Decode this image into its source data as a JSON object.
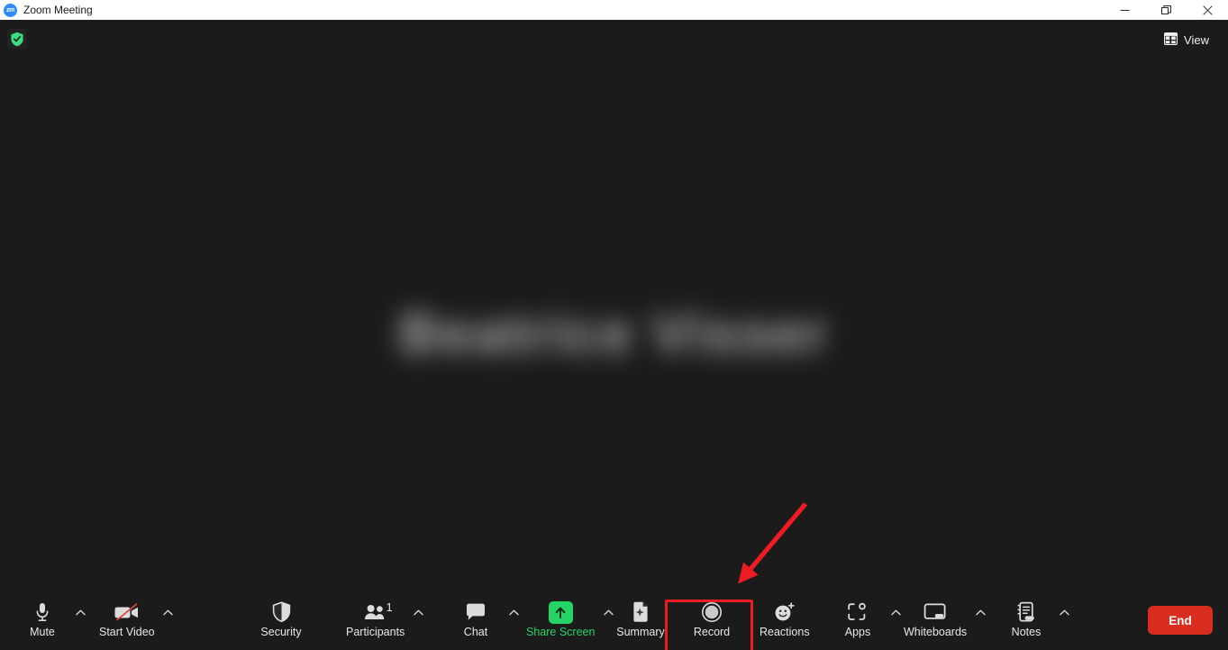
{
  "window": {
    "title": "Zoom Meeting",
    "logo_text": "zm",
    "controls": {
      "minimize": "minimize-icon",
      "maximize": "maximize-icon",
      "close": "close-icon"
    }
  },
  "stage": {
    "encryption_icon": "shield-check-icon",
    "encryption_color": "#3ddc84",
    "view_label": "View",
    "view_icon": "grid-view-icon",
    "participant_name_large": "Beatrice Visser",
    "participant_name_label": "Beatrice Visser"
  },
  "annotation": {
    "arrow_color": "#ed1c24",
    "highlight_color": "#ed1c24",
    "highlighted_control": "Record"
  },
  "toolbar": {
    "items": [
      {
        "label": "Mute",
        "icon": "microphone-icon",
        "caret": true,
        "badge": null,
        "accent": false
      },
      {
        "label": "Start Video",
        "icon": "video-off-icon",
        "caret": true,
        "badge": null,
        "accent": false
      },
      {
        "label": "Security",
        "icon": "shield-icon",
        "caret": false,
        "badge": null,
        "accent": false
      },
      {
        "label": "Participants",
        "icon": "people-icon",
        "caret": true,
        "badge": "1",
        "accent": false
      },
      {
        "label": "Chat",
        "icon": "chat-bubble-icon",
        "caret": true,
        "badge": null,
        "accent": false
      },
      {
        "label": "Share Screen",
        "icon": "share-screen-icon",
        "caret": true,
        "badge": null,
        "accent": true
      },
      {
        "label": "Summary",
        "icon": "summary-doc-icon",
        "caret": false,
        "badge": null,
        "accent": false
      },
      {
        "label": "Record",
        "icon": "record-circle-icon",
        "caret": false,
        "badge": null,
        "accent": false
      },
      {
        "label": "Reactions",
        "icon": "reactions-icon",
        "caret": false,
        "badge": null,
        "accent": false
      },
      {
        "label": "Apps",
        "icon": "apps-icon",
        "caret": true,
        "badge": null,
        "accent": false
      },
      {
        "label": "Whiteboards",
        "icon": "whiteboard-icon",
        "caret": true,
        "badge": null,
        "accent": false
      },
      {
        "label": "Notes",
        "icon": "notes-icon",
        "caret": true,
        "badge": null,
        "accent": false
      }
    ],
    "end_label": "End",
    "end_color": "#d92d20",
    "accent_color": "#26d367"
  }
}
